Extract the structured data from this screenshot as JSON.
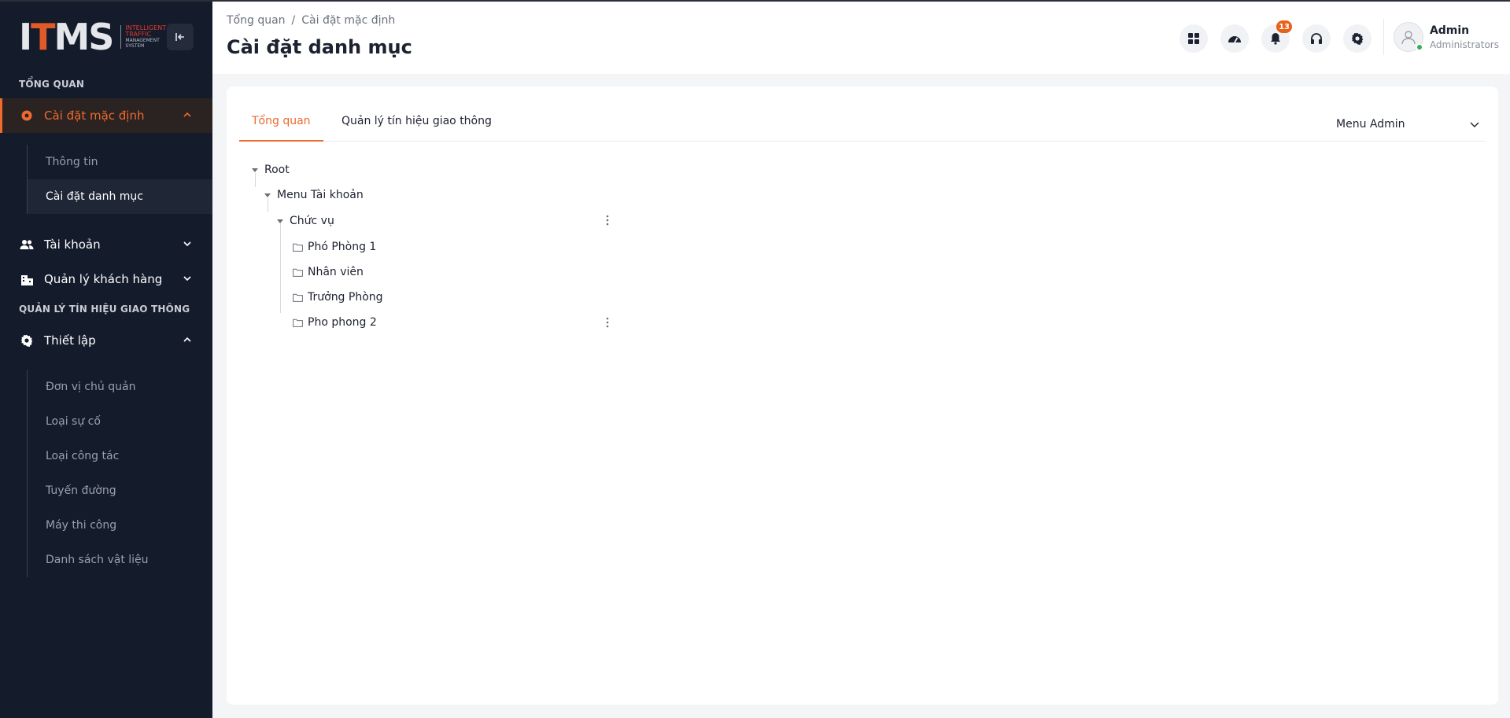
{
  "logo": {
    "mark": "ITMS",
    "line1": "INTELLIGENT",
    "line2": "TRAFFIC",
    "line3": "MANAGEMENT",
    "line4": "SYSTEM"
  },
  "sidebar": {
    "section_overview": "TỔNG QUAN",
    "default_settings": "Cài đặt mặc định",
    "default_settings_items": [
      "Thông tin",
      "Cài đặt danh mục"
    ],
    "accounts": "Tài khoản",
    "customers": "Quản lý khách hàng",
    "section_traffic": "QUẢN LÝ TÍN HIỆU GIAO THÔNG",
    "setup": "Thiết lập",
    "setup_items": [
      "Đơn vị chủ quản",
      "Loại sự cố",
      "Loại công tác",
      "Tuyến đường",
      "Máy thi công",
      "Danh sách vật liệu"
    ]
  },
  "header": {
    "breadcrumb": [
      "Tổng quan",
      "/",
      "Cài đặt mặc định"
    ],
    "title": "Cài đặt danh mục",
    "notification_count": "13",
    "user_name": "Admin",
    "user_role": "Administrators"
  },
  "tabs": [
    "Tổng quan",
    "Quản lý tín hiệu giao thông"
  ],
  "menu_select": {
    "value": "Menu Admin"
  },
  "tree": {
    "root": "Root",
    "menu": "Menu Tài khoản",
    "group": "Chức vụ",
    "leaves": [
      "Phó Phòng 1",
      "Nhân viên",
      "Trưởng Phòng",
      "Pho phong 2"
    ]
  },
  "colors": {
    "accent": "#ee6a2f",
    "sidebar_bg": "#141b2b",
    "badge": "#e8611c",
    "online": "#2eb34f"
  }
}
